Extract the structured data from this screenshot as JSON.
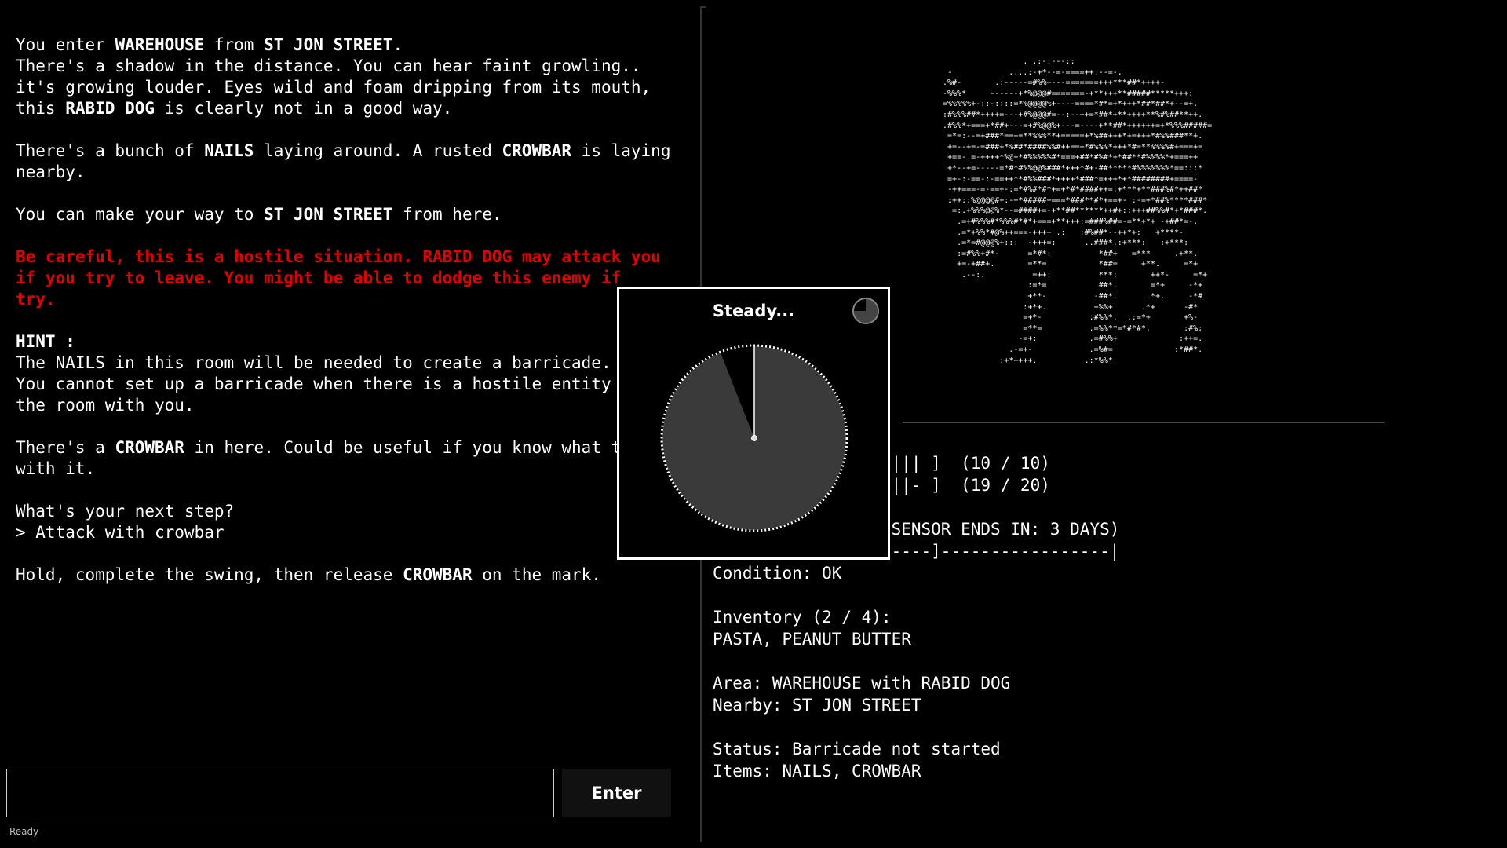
{
  "story": [
    [
      {
        "t": "You enter "
      },
      {
        "t": "WAREHOUSE",
        "b": true
      },
      {
        "t": " from "
      },
      {
        "t": "ST JON STREET",
        "b": true
      },
      {
        "t": "."
      }
    ],
    [
      {
        "t": "There's a shadow in the distance. You can hear faint growling.."
      }
    ],
    [
      {
        "t": "it's growing louder. Eyes wild and foam dripping from its mouth,"
      }
    ],
    [
      {
        "t": "this "
      },
      {
        "t": "RABID DOG",
        "b": true
      },
      {
        "t": " is clearly not in a good way."
      }
    ],
    [],
    [
      {
        "t": "There's a bunch of "
      },
      {
        "t": "NAILS",
        "b": true
      },
      {
        "t": " laying around. A rusted "
      },
      {
        "t": "CROWBAR",
        "b": true
      },
      {
        "t": " is laying"
      }
    ],
    [
      {
        "t": "nearby."
      }
    ],
    [],
    [
      {
        "t": "You can make your way to "
      },
      {
        "t": "ST JON STREET",
        "b": true
      },
      {
        "t": " from here."
      }
    ],
    [],
    [
      {
        "t": "Be careful, this is a hostile situation. RABID DOG may attack you",
        "red": true
      }
    ],
    [
      {
        "t": "if you try to leave. You might be able to dodge this enemy if",
        "red": true
      }
    ],
    [
      {
        "t": "try.",
        "red": true
      }
    ],
    [],
    [
      {
        "t": "HINT :",
        "b": true
      }
    ],
    [
      {
        "t": "The NAILS in this room will be needed to create a barricade."
      }
    ],
    [
      {
        "t": "You cannot set up a barricade when there is a hostile entity in"
      }
    ],
    [
      {
        "t": "the room with you."
      }
    ],
    [],
    [
      {
        "t": "There's a "
      },
      {
        "t": "CROWBAR",
        "b": true
      },
      {
        "t": " in here. Could be useful if you know what to do"
      }
    ],
    [
      {
        "t": "with it."
      }
    ],
    [],
    [
      {
        "t": "What's your next step?"
      }
    ],
    [
      {
        "t": "> Attack with crowbar"
      }
    ],
    [],
    [
      {
        "t": "Hold, complete the swing, then release "
      },
      {
        "t": "CROWBAR",
        "b": true
      },
      {
        "t": " on the mark."
      }
    ]
  ],
  "input": {
    "value": "",
    "placeholder": ""
  },
  "enter_label": "Enter",
  "status_text": "Ready",
  "ascii_art": "                  . .:-:---::\n  -            ....:-+*--=-====++:--=-.\n .%#-       .:-----=#%%+---=======+++***##*++++-\n -%%%*     ------+*%@@@#=======-+**+++**#####*****+++:\n =%%%%%+-::-::::=*%@@@@%+----====*#*=+*+++*##*##*+--=+.\n :#%%%##*++++=---+#%@@@#=--:--++=*##*+**++++**%#%##**++.\n .#%%*+===+*##+---=+#%@@%+---=----+**##*++++++=+*%%%#####=\n  =*=:--=+###*==+=**%%%**+=====+*%##+++*+=+++*#%%###**+.\n  +=--+=-=###+*%##*####%%#++==+*#%%%*+++*#=**%%%%#+===+=\n  +==-.=-++++*%@+*#%%%%%#*===+##*#%#*+*##**#%%%%*+===++\n  +*--+=-----=*#*#%%@@%###*+++*#+-##*****#%%%%%%%*==:::*\n  =+-:-==-:-==++**#%%###*++++*###*=+++*+*########+====-\n  -++===-=-==+-:=*#%#*#*+=+*#*####++=:+***+**###%#*++##*\n  :++::%@@@@#+:-+*#####+===*###**#*+==+- :-=+*##%****###*\n   =:.+%%%@@%*--=####+=-+**##******++#+::+++##%%#*+*###*.\n    .=+#%%%#*%%%#*#*+===+**+++:=###%##=-=**+*+ -+##*=-.\n    .=*+%%*#@%++===-++++ .:   :#%##*--++*+:   +****-\n    .=*=#@@@%+:::  -+++=:      ..###*.:+***:   :+***:\n    :=#%%+#*-      =*#*:          *##+   =***     .+**.\n    +=-+##+.       =**=           *##=     +**.     =*+\n     .--:.          =++:          ***:       ++*-     =*+\n                   :=*=           ##*.       =*+     -*+\n                   +**-          -##*.      .*+.     -*#\n                  :+*+.          +%%+      .*+      -#*\n                  =+*-          .#%%*.  .:=*+       +%-\n                  =**=          .=%%**=*#*#*.       :#%:\n                 -=+:           .=#%%+             :++=.\n               .-=+-            .=%#=             :*##*.\n             :+*++++.          .:*%%*",
  "stats": [
    "          ||||||||||| ]  (10 / 10)",
    "          ||||||||||- ]  (19 / 20)",
    "",
    "          mmol/L (SENSOR ENDS IN: 3 DAYS)",
    "          -[-I--------]-----------------|",
    "Condition: OK",
    "",
    "Inventory (2 / 4):",
    "PASTA, PEANUT BUTTER",
    "",
    "Area: WAREHOUSE with RABID DOG",
    "Nearby: ST JON STREET",
    "",
    "Status: Barricade not started",
    "Items: NAILS, CROWBAR"
  ],
  "modal": {
    "title": "Steady...",
    "swing_progress": 0.94,
    "timer_progress": 0.75
  },
  "colors": {
    "background": "#000000",
    "danger": "#e60000",
    "dial_fill": "#3a3a3a"
  }
}
